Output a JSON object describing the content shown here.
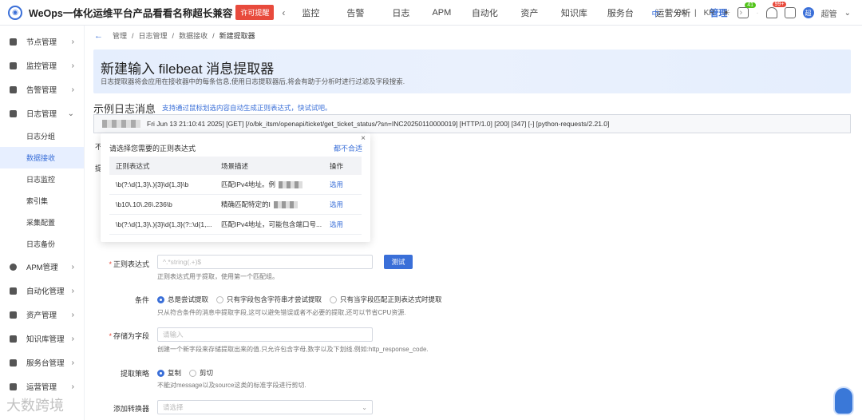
{
  "topbar": {
    "brand": "WeOps一体化运维平台产品看看名称超长兼容",
    "license_badge": "许可提醒",
    "nav": [
      "监控",
      "告警",
      "日志",
      "APM",
      "自动化",
      "资产",
      "知识库",
      "服务台",
      "运营分析",
      "管理"
    ],
    "active_nav": "管理",
    "languages": [
      "中",
      "EN",
      "KR"
    ],
    "notif_count": "41",
    "alert_count": "99+",
    "user_initial": "超",
    "user_name": "超管"
  },
  "sidebar": {
    "items": [
      {
        "label": "节点管理"
      },
      {
        "label": "监控管理"
      },
      {
        "label": "告警管理"
      },
      {
        "label": "日志管理"
      }
    ],
    "log_subitems": [
      "日志分组",
      "数据接收",
      "日志监控",
      "索引集",
      "采集配置",
      "日志备份"
    ],
    "active_sub": "数据接收",
    "items_after": [
      {
        "label": "APM管理"
      },
      {
        "label": "自动化管理"
      },
      {
        "label": "资产管理"
      },
      {
        "label": "知识库管理"
      },
      {
        "label": "服务台管理"
      },
      {
        "label": "运营管理"
      }
    ]
  },
  "breadcrumb": [
    "管理",
    "日志管理",
    "数据接收",
    "新建提取器"
  ],
  "header": {
    "title": "新建输入 filebeat 消息提取器",
    "desc": "日志提取器将会应用在接收器中的每条信息,使用日志提取器后,将会有助于分析时进行过滤及字段搜索."
  },
  "example": {
    "title": "示例日志消息",
    "hint": "支持通过鼠标划选内容自动生成正则表达式，快试试吧。",
    "log": "Fri Jun 13 21:10:41 2025] [GET] [/o/bk_itsm/openapi/ticket/get_ticket_status/?sn=INC20250110000019] [HTTP/1.0] [200] [347] [-] [python-requests/2.21.0]",
    "label_no": "不",
    "label_ti": "提"
  },
  "popover": {
    "title": "请选择您需要的正则表达式",
    "none_fit": "都不合适",
    "close": "×",
    "columns": [
      "正则表达式",
      "场景描述",
      "操作"
    ],
    "rows": [
      {
        "regex": "\\b(?:\\d{1,3}\\.){3}\\d{1,3}\\b",
        "desc": "匹配IPv4地址。例",
        "action": "选用"
      },
      {
        "regex": "\\b10\\.10\\.26\\.236\\b",
        "desc": "精确匹配特定的I",
        "action": "选用"
      },
      {
        "regex": "\\b(?:\\d{1,3}\\.){3}\\d{1,3}(?::\\d{1,...",
        "desc": "匹配IPv4地址，可能包含端口号...",
        "action": "选用"
      }
    ]
  },
  "form": {
    "regex_label": "正则表达式",
    "regex_placeholder": "^.*string(.+)$",
    "test_button": "测试",
    "regex_help": "正则表达式用于提取，使用第一个匹配组。",
    "condition_label": "条件",
    "condition_options": [
      "总是尝试提取",
      "只有字段包含字符串才尝试提取",
      "只有当字段匹配正则表达式时提取"
    ],
    "condition_help": "只从符合条件的消息中提取字段,这可以避免错误或者不必要的提取,还可以节省CPU资源.",
    "store_label": "存储为字段",
    "store_placeholder": "请输入",
    "store_help": "创建一个新字段来存储提取出来的值.只允许包含字母,数字以及下划线.例如:http_response_code.",
    "strategy_label": "提取策略",
    "strategy_options": [
      "复制",
      "剪切"
    ],
    "strategy_help": "不能对message以及source这类的标准字段进行剪切.",
    "converter_label": "添加转换器",
    "converter_placeholder": "请选择"
  },
  "watermark": "大数跨境",
  "colors": {
    "primary": "#3a6fd8",
    "danger": "#e84a3c",
    "success": "#52c41a"
  }
}
